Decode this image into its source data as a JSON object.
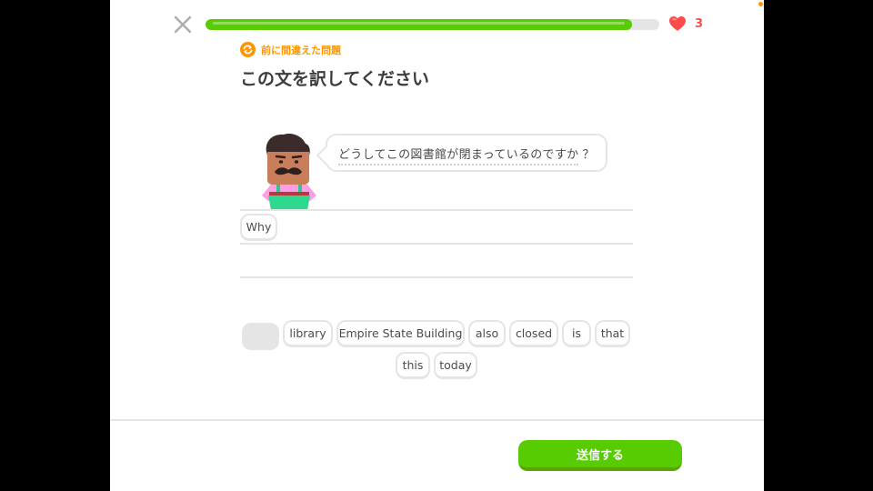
{
  "header": {
    "close_icon": "close-icon",
    "progress_fraction": 0.94,
    "hearts": "3",
    "heart_color": "#ff4b4b"
  },
  "badge": {
    "label": "前に間違えた問題",
    "icon": "repeat-icon",
    "color": "#ff9600"
  },
  "prompt": {
    "title": "この文を訳してください",
    "sentence": "どうしてこの図書館が閉まっているのですか",
    "punctuation": "？"
  },
  "answer": {
    "selected": [
      "Why"
    ]
  },
  "word_bank": [
    {
      "label": "",
      "used": true
    },
    {
      "label": "library"
    },
    {
      "label": "Empire State Building"
    },
    {
      "label": "also"
    },
    {
      "label": "closed"
    },
    {
      "label": "is"
    },
    {
      "label": "that"
    },
    {
      "label": "this"
    },
    {
      "label": "today"
    }
  ],
  "footer": {
    "submit_label": "送信する",
    "accent_color": "#58cc02"
  }
}
